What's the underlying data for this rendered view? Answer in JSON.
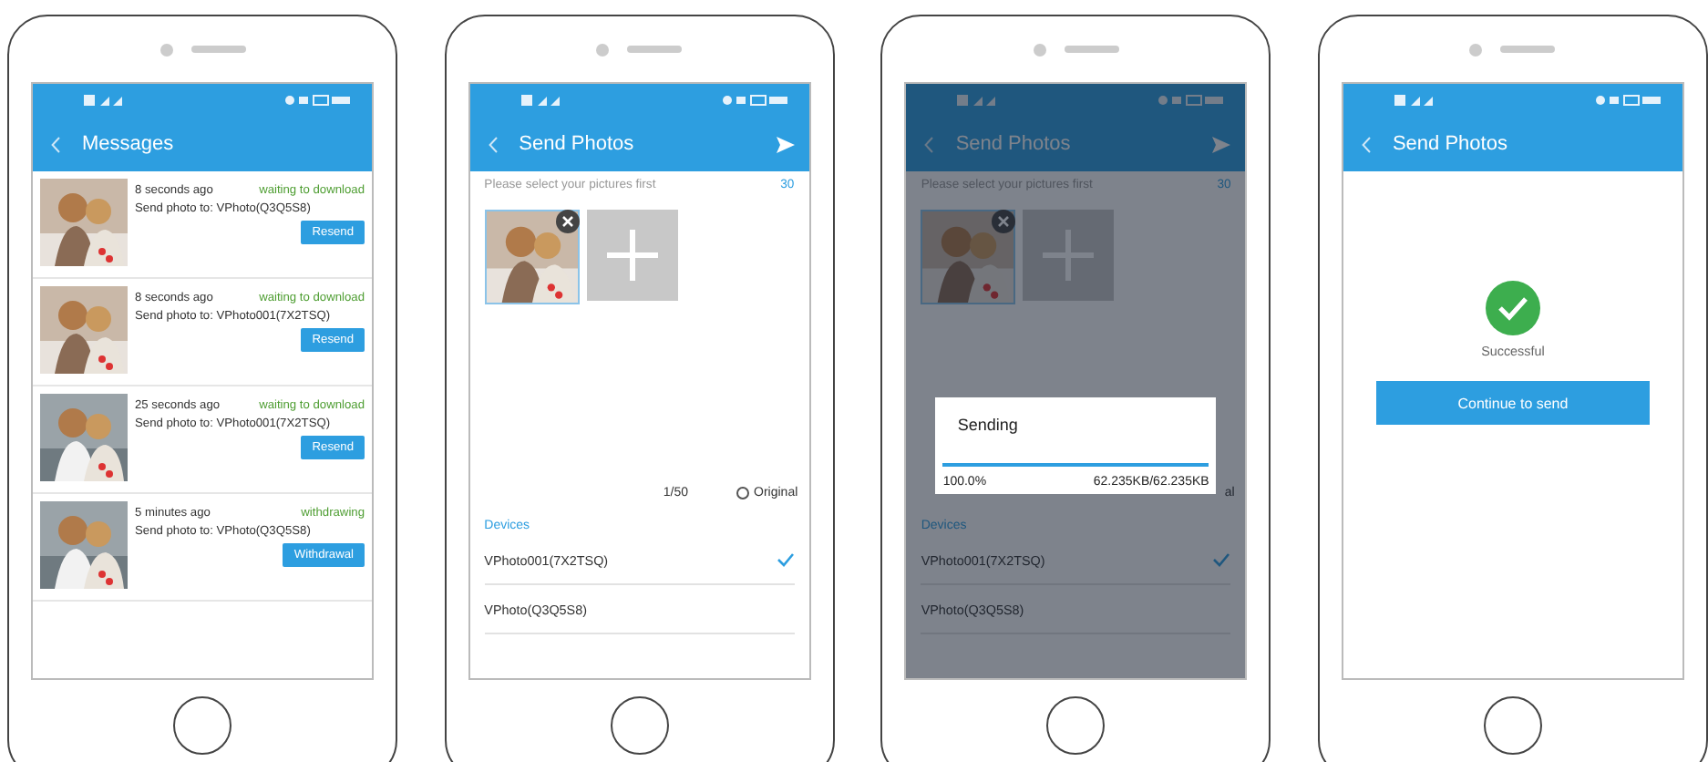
{
  "phones": [
    {
      "kind": "messages",
      "title": "Messages",
      "messages": [
        {
          "time": "8 seconds ago",
          "status": "waiting to download",
          "recipient": "Send photo to: VPhoto(Q3Q5S8)",
          "action": "Resend"
        },
        {
          "time": "8 seconds ago",
          "status": "waiting to download",
          "recipient": "Send photo to: VPhoto001(7X2TSQ)",
          "action": "Resend"
        },
        {
          "time": "25 seconds ago",
          "status": "waiting to download",
          "recipient": "Send photo to: VPhoto001(7X2TSQ)",
          "action": "Resend"
        },
        {
          "time": "5 minutes ago",
          "status": "withdrawing",
          "recipient": "Send photo to: VPhoto(Q3Q5S8)",
          "action": "Withdrawal"
        }
      ]
    },
    {
      "kind": "send",
      "title": "Send Photos",
      "hint": "Please select your pictures first",
      "limit": "30",
      "footer": {
        "count": "1/50",
        "radio": true,
        "original": "Original"
      },
      "devices_label": "Devices",
      "devices": [
        {
          "name": "VPhoto001(7X2TSQ)",
          "selected": true
        },
        {
          "name": "VPhoto(Q3Q5S8)",
          "selected": false
        }
      ]
    },
    {
      "kind": "send",
      "title": "Send Photos",
      "hint": "Please select your pictures first",
      "limit": "30",
      "footer": {
        "radio": false,
        "original": "al"
      },
      "devices_label": "Devices",
      "devices": [
        {
          "name": "VPhoto001(7X2TSQ)",
          "selected": true
        },
        {
          "name": "VPhoto(Q3Q5S8)",
          "selected": false
        }
      ],
      "dialog": {
        "title": "Sending",
        "level": 1.0,
        "percent": "100.0%",
        "size": "62.235KB/62.235KB"
      }
    },
    {
      "kind": "success",
      "title": "Send Photos",
      "message": "Successful",
      "button": "Continue to send"
    }
  ]
}
